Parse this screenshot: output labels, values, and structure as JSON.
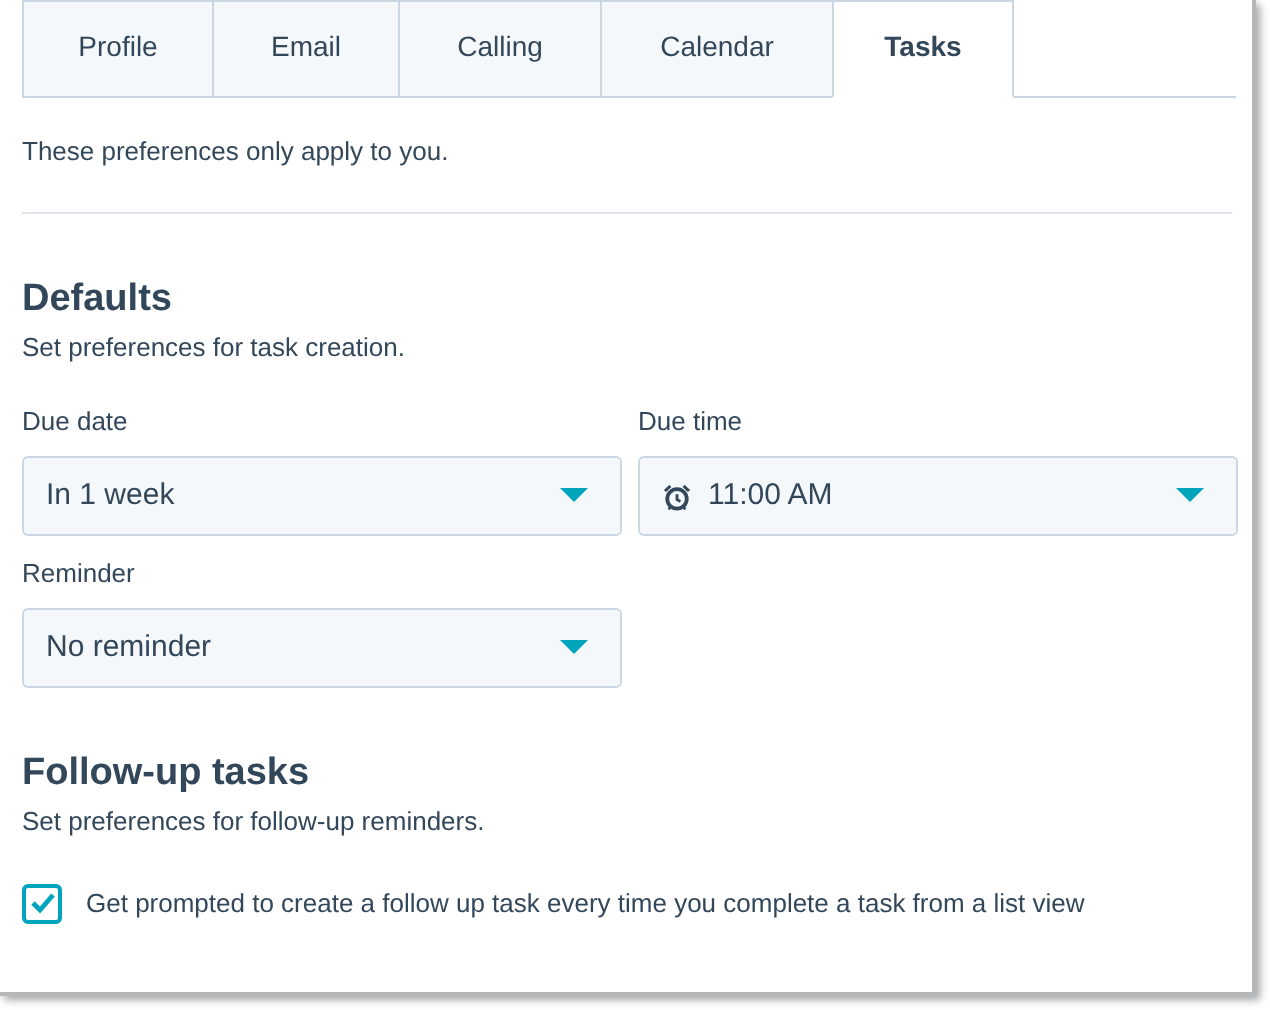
{
  "tabs": [
    {
      "label": "Profile",
      "selected": false
    },
    {
      "label": "Email",
      "selected": false
    },
    {
      "label": "Calling",
      "selected": false
    },
    {
      "label": "Calendar",
      "selected": false
    },
    {
      "label": "Tasks",
      "selected": true
    }
  ],
  "note": "These preferences only apply to you.",
  "defaults": {
    "title": "Defaults",
    "subtitle": "Set preferences for task creation.",
    "fields": [
      {
        "label": "Due date",
        "value": "In 1 week",
        "kind": "plain"
      },
      {
        "label": "Due time",
        "value": "11:00 AM",
        "kind": "time"
      },
      {
        "label": "Reminder",
        "value": "No reminder",
        "kind": "plain"
      }
    ]
  },
  "follow_up": {
    "title": "Follow-up tasks",
    "subtitle": "Set preferences for follow-up reminders.",
    "option": {
      "label": "Get prompted to create a follow up task every time you complete a task from a list view",
      "checked": true
    }
  }
}
